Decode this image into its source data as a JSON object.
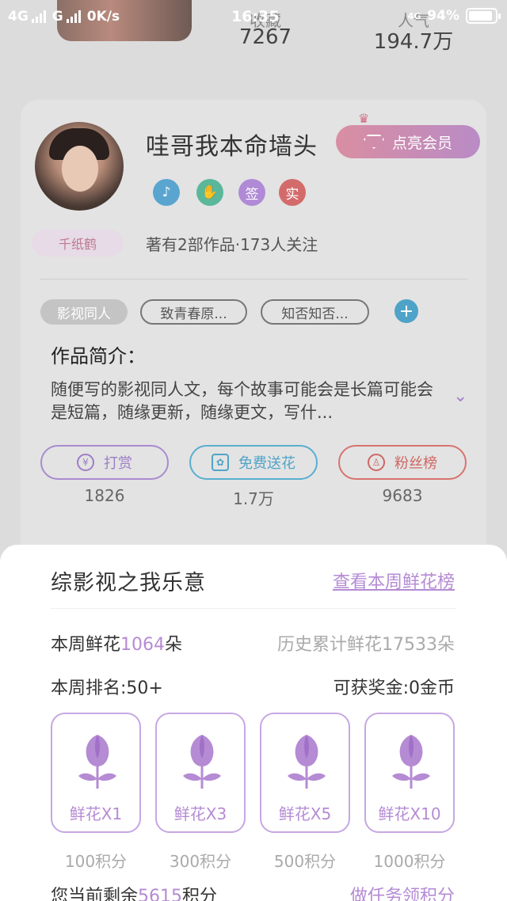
{
  "status_bar": {
    "left": "4G  G  0K/s",
    "net1": "4G",
    "net2": "G",
    "speed": "0K/s",
    "time": "16:35",
    "net3": "4G",
    "battery": "94%"
  },
  "top_stats": {
    "favorites_label": "收藏",
    "favorites_value": "7267",
    "popularity_label": "人气",
    "popularity_value": "194.7万"
  },
  "author": {
    "name": "哇哥我本命墙头",
    "vip_label": "点亮会员",
    "badges": [
      "♪",
      "✋",
      "签",
      "实"
    ],
    "tag": "千纸鹤",
    "works_summary": "著有2部作品·173人关注"
  },
  "tags": {
    "main": "影视同人",
    "t2": "致青春原...",
    "t3": "知否知否...",
    "add": "+"
  },
  "intro": {
    "title": "作品简介：",
    "text": "随便写的影视同人文，每个故事可能会是长篇可能会是短篇，随缘更新，随缘更文，写什...",
    "expand_icon": "chevron-down-icon"
  },
  "actions": [
    {
      "label": "打赏",
      "icon": "¥",
      "count": "1826"
    },
    {
      "label": "免费送花",
      "icon": "✿",
      "count": "1.7万"
    },
    {
      "label": "粉丝榜",
      "icon": "♙",
      "count": "9683"
    }
  ],
  "sheet": {
    "title": "综影视之我乐意",
    "ranking_link": "查看本周鲜花榜",
    "week_flowers_prefix": "本周鲜花",
    "week_flowers_value": "1064",
    "week_flowers_suffix": "朵",
    "history_flowers": "历史累计鲜花17533朵",
    "week_rank": "本周排名:50+",
    "reward": "可获奖金:0金币",
    "options": [
      {
        "label": "鲜花X1",
        "cost": "100积分"
      },
      {
        "label": "鲜花X3",
        "cost": "300积分"
      },
      {
        "label": "鲜花X5",
        "cost": "500积分"
      },
      {
        "label": "鲜花X10",
        "cost": "1000积分"
      }
    ],
    "remaining_prefix": "您当前剩余",
    "remaining_value": "5615",
    "remaining_suffix": "积分",
    "task_link": "做任务领积分"
  },
  "colors": {
    "accent": "#b58bd4",
    "flower": "#b58bd4",
    "dim_overlay": "#dcdcdc"
  }
}
